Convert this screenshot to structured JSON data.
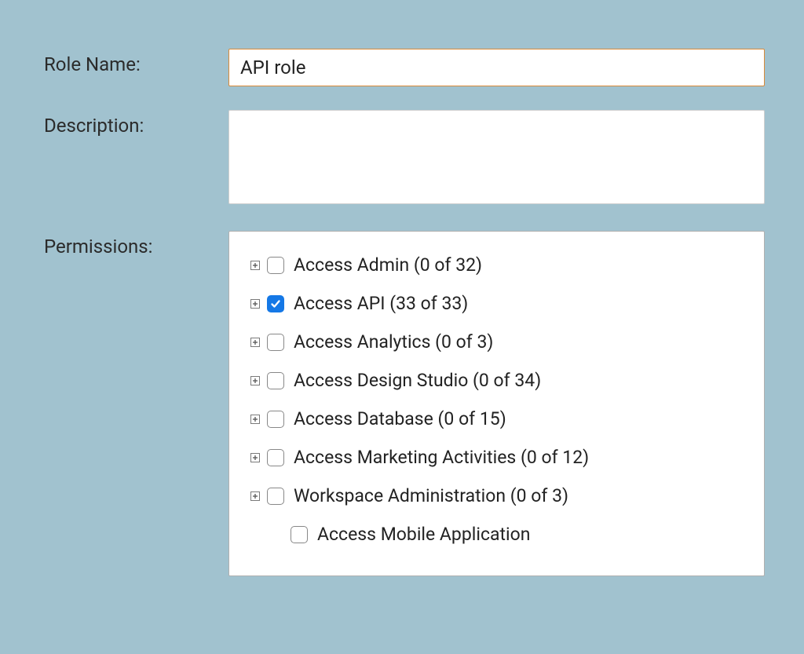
{
  "labels": {
    "role_name": "Role Name:",
    "description": "Description:",
    "permissions": "Permissions:"
  },
  "fields": {
    "role_name_value": "API role",
    "description_value": ""
  },
  "permissions": [
    {
      "label": "Access Admin (0 of 32)",
      "checked": false,
      "expandable": true
    },
    {
      "label": "Access API (33 of 33)",
      "checked": true,
      "expandable": true
    },
    {
      "label": "Access Analytics (0 of 3)",
      "checked": false,
      "expandable": true
    },
    {
      "label": "Access Design Studio (0 of 34)",
      "checked": false,
      "expandable": true
    },
    {
      "label": "Access Database (0 of 15)",
      "checked": false,
      "expandable": true
    },
    {
      "label": "Access Marketing Activities (0 of 12)",
      "checked": false,
      "expandable": true
    },
    {
      "label": "Workspace Administration (0 of 3)",
      "checked": false,
      "expandable": true
    },
    {
      "label": "Access Mobile Application",
      "checked": false,
      "expandable": false
    }
  ]
}
